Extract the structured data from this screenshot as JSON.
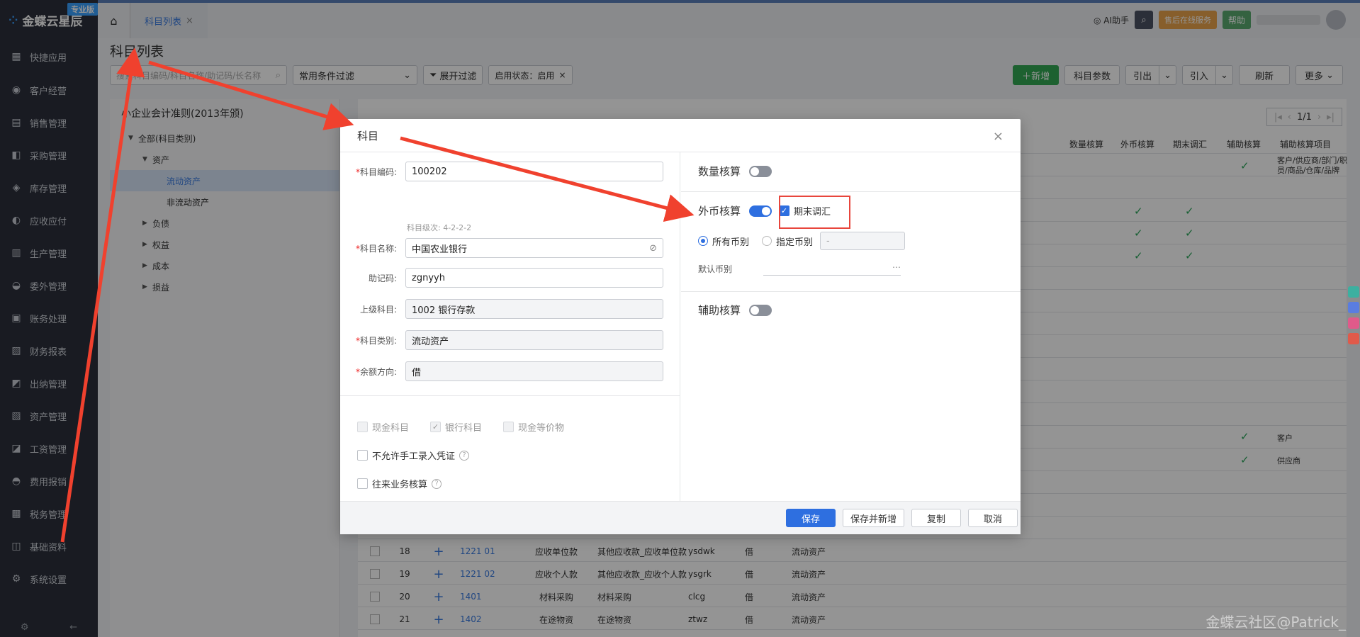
{
  "sidebar": {
    "logo": "金蝶云星辰",
    "edition": "专业版",
    "items": [
      {
        "label": "快捷应用",
        "icon": "grid-icon"
      },
      {
        "label": "客户经营",
        "icon": "user-icon"
      },
      {
        "label": "销售管理",
        "icon": "chart-icon"
      },
      {
        "label": "采购管理",
        "icon": "cart-icon"
      },
      {
        "label": "库存管理",
        "icon": "box-icon"
      },
      {
        "label": "应收应付",
        "icon": "exchange-icon"
      },
      {
        "label": "生产管理",
        "icon": "factory-icon"
      },
      {
        "label": "委外管理",
        "icon": "outsource-icon"
      },
      {
        "label": "账务处理",
        "icon": "ledger-icon"
      },
      {
        "label": "财务报表",
        "icon": "report-icon"
      },
      {
        "label": "出纳管理",
        "icon": "cashier-icon"
      },
      {
        "label": "资产管理",
        "icon": "asset-icon"
      },
      {
        "label": "工资管理",
        "icon": "salary-icon"
      },
      {
        "label": "费用报销",
        "icon": "expense-icon"
      },
      {
        "label": "税务管理",
        "icon": "tax-icon"
      },
      {
        "label": "基础资料",
        "icon": "layers-icon"
      },
      {
        "label": "系统设置",
        "icon": "settings-icon"
      }
    ]
  },
  "topbar": {
    "tab": "科目列表",
    "ai": "AI助手",
    "service": "售后在线服务",
    "help": "帮助"
  },
  "page": {
    "title": "科目列表",
    "search_placeholder": "搜索科目编码/科目名称/助记码/长名称",
    "filter_select": "常用条件过滤",
    "expand": "展开过滤",
    "status_tag": "启用状态：启用",
    "actions": {
      "new": "新增",
      "params": "科目参数",
      "export": "引出",
      "import": "引入",
      "refresh": "刷新",
      "more": "更多"
    },
    "pager": "1/1"
  },
  "tree": {
    "title": "小企业会计准则(2013年颁)",
    "nodes": [
      {
        "label": "全部(科目类别)",
        "level": 0,
        "arrow": "▼"
      },
      {
        "label": "资产",
        "level": 1,
        "arrow": "▼"
      },
      {
        "label": "流动资产",
        "level": 2,
        "arrow": "",
        "selected": true
      },
      {
        "label": "非流动资产",
        "level": 2,
        "arrow": ""
      },
      {
        "label": "负债",
        "level": 1,
        "arrow": "▶"
      },
      {
        "label": "权益",
        "level": 1,
        "arrow": "▶"
      },
      {
        "label": "成本",
        "level": 1,
        "arrow": "▶"
      },
      {
        "label": "损益",
        "level": 1,
        "arrow": "▶"
      }
    ]
  },
  "grid": {
    "headers": [
      "数量核算",
      "外币核算",
      "期末调汇",
      "辅助核算",
      "辅助核算项目"
    ],
    "aux_items": [
      "客户/供应商/部门/职员/商品/仓库/品牌",
      "客户",
      "供应商"
    ],
    "rows": [
      {
        "no": "18",
        "code": "1221 01",
        "name": "应收单位款",
        "full": "其他应收款_应收单位款",
        "mnem": "ysdwk",
        "dir": "借",
        "cat": "流动资产"
      },
      {
        "no": "19",
        "code": "1221 02",
        "name": "应收个人款",
        "full": "其他应收款_应收个人款",
        "mnem": "ysgrk",
        "dir": "借",
        "cat": "流动资产"
      },
      {
        "no": "20",
        "code": "1401",
        "name": "材料采购",
        "full": "材料采购",
        "mnem": "clcg",
        "dir": "借",
        "cat": "流动资产"
      },
      {
        "no": "21",
        "code": "1402",
        "name": "在途物资",
        "full": "在途物资",
        "mnem": "ztwz",
        "dir": "借",
        "cat": "流动资产"
      }
    ]
  },
  "modal": {
    "title": "科目",
    "fields": {
      "code_label": "科目编码:",
      "code_value": "100202",
      "level_hint": "科目级次: 4-2-2-2",
      "name_label": "科目名称:",
      "name_value": "中国农业银行",
      "mnem_label": "助记码:",
      "mnem_value": "zgnyyh",
      "parent_label": "上级科目:",
      "parent_value": "1002 银行存款",
      "cat_label": "科目类别:",
      "cat_value": "流动资产",
      "dir_label": "余额方向:",
      "dir_value": "借"
    },
    "checks": {
      "cash": "现金科目",
      "bank": "银行科目",
      "cash_eq": "现金等价物",
      "no_manual": "不允许手工录入凭证",
      "ar_ap": "往来业务核算"
    },
    "right": {
      "qty": "数量核算",
      "fx": "外币核算",
      "period_end": "期末调汇",
      "all_ccy": "所有币别",
      "spec_ccy": "指定币别",
      "spec_placeholder": "-",
      "default_ccy": "默认币别",
      "aux": "辅助核算"
    },
    "footer": {
      "save": "保存",
      "save_new": "保存并新增",
      "copy": "复制",
      "cancel": "取消"
    },
    "colors": {
      "primary": "#2e6fe0",
      "highlight": "#e8453c"
    }
  },
  "watermark": "金蝶云社区@Patrick_"
}
